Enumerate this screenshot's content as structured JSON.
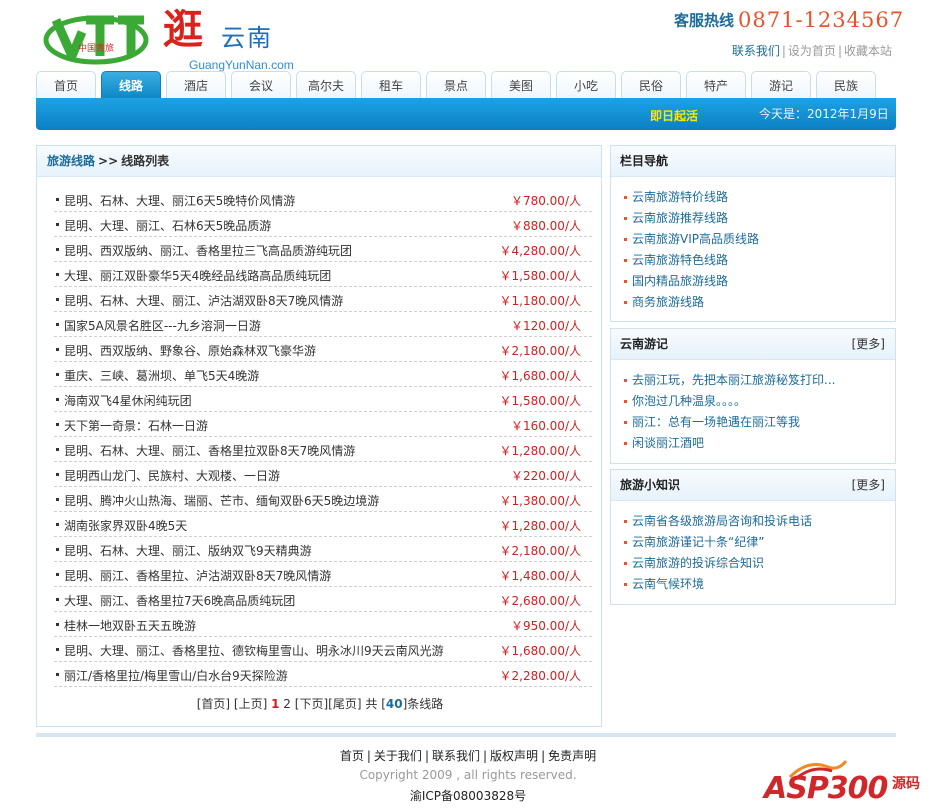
{
  "header": {
    "logo_vtt_text": "中国青旅",
    "logo_guang_big": "逛",
    "logo_guang_small": "云南",
    "logo_url": "GuangYunNan.com",
    "hotline_label": "客服热线",
    "hotline_number": "0871-1234567",
    "top_links": [
      "联系我们",
      "设为首页",
      "收藏本站"
    ]
  },
  "nav": {
    "tabs": [
      "首页",
      "线路",
      "酒店",
      "会议",
      "高尔夫",
      "租车",
      "景点",
      "美图",
      "小吃",
      "民俗",
      "特产",
      "游记",
      "民族"
    ],
    "active_index": 1
  },
  "banner": {
    "marquee": "即日起活",
    "today": "今天是：2012年1月9日"
  },
  "main": {
    "breadcrumb_root": "旅游线路",
    "breadcrumb_sep": ">>",
    "breadcrumb_current": "线路列表",
    "routes": [
      {
        "name": "昆明、石林、大理、丽江6天5晚特价风情游",
        "price": "￥780.00/人"
      },
      {
        "name": "昆明、大理、丽江、石林6天5晚品质游",
        "price": "￥880.00/人"
      },
      {
        "name": "昆明、西双版纳、丽江、香格里拉三飞高品质游纯玩团",
        "price": "￥4,280.00/人"
      },
      {
        "name": "大理、丽江双卧豪华5天4晚经品线路高品质纯玩团",
        "price": "￥1,580.00/人"
      },
      {
        "name": "昆明、石林、大理、丽江、泸沽湖双卧8天7晚风情游",
        "price": "￥1,180.00/人"
      },
      {
        "name": "国家5A风景名胜区---九乡溶洞一日游",
        "price": "￥120.00/人"
      },
      {
        "name": "昆明、西双版纳、野象谷、原始森林双飞豪华游",
        "price": "￥2,180.00/人"
      },
      {
        "name": "重庆、三峡、葛洲坝、单飞5天4晚游",
        "price": "￥1,680.00/人"
      },
      {
        "name": "海南双飞4星休闲纯玩团",
        "price": "￥1,580.00/人"
      },
      {
        "name": "天下第一奇景：石林一日游",
        "price": "￥160.00/人"
      },
      {
        "name": "昆明、石林、大理、丽江、香格里拉双卧8天7晚风情游",
        "price": "￥1,280.00/人"
      },
      {
        "name": "昆明西山龙门、民族村、大观楼、一日游",
        "price": "￥220.00/人"
      },
      {
        "name": "昆明、腾冲火山热海、瑞丽、芒市、缅甸双卧6天5晚边境游",
        "price": "￥1,380.00/人"
      },
      {
        "name": "湖南张家界双卧4晚5天",
        "price": "￥1,280.00/人"
      },
      {
        "name": "昆明、石林、大理、丽江、版纳双飞9天精典游",
        "price": "￥2,180.00/人"
      },
      {
        "name": "昆明、丽江、香格里拉、泸沽湖双卧8天7晚风情游",
        "price": "￥1,480.00/人"
      },
      {
        "name": "大理、丽江、香格里拉7天6晚高品质纯玩团",
        "price": "￥2,680.00/人"
      },
      {
        "name": "桂林一地双卧五天五晚游",
        "price": "￥950.00/人"
      },
      {
        "name": "昆明、大理、丽江、香格里拉、德钦梅里雪山、明永冰川9天云南风光游",
        "price": "￥1,680.00/人"
      },
      {
        "name": "丽江/香格里拉/梅里雪山/白水台9天探险游",
        "price": "￥2,280.00/人"
      }
    ],
    "pager": {
      "first": "[首页]",
      "prev": "[上页]",
      "current": "1",
      "other": "2",
      "next": "[下页]",
      "last": "[尾页]",
      "total_prefix": "共",
      "total_open": "[",
      "total": "40",
      "total_close": "]",
      "total_suffix": "条线路"
    }
  },
  "sidebar": {
    "nav_box": {
      "title": "栏目导航",
      "items": [
        "云南旅游特价线路",
        "云南旅游推荐线路",
        "云南旅游VIP高品质线路",
        "云南旅游特色线路",
        "国内精品旅游线路",
        "商务旅游线路"
      ]
    },
    "travel_notes": {
      "title": "云南游记",
      "more": "[更多]",
      "items": [
        "去丽江玩，先把本丽江旅游秘笈打印...",
        "你泡过几种温泉。。。。",
        "丽江：总有一场艳遇在丽江等我",
        "闲谈丽江酒吧"
      ]
    },
    "knowledge": {
      "title": "旅游小知识",
      "more": "[更多]",
      "items": [
        "云南省各级旅游局咨询和投诉电话",
        "云南旅游谨记十条“纪律”",
        "云南旅游的投诉综合知识",
        "云南气候环境"
      ]
    }
  },
  "footer": {
    "links": [
      "首页",
      "关于我们",
      "联系我们",
      "版权声明",
      "免责声明"
    ],
    "copyright": "Copyright 2009 , all rights reserved.",
    "icp": "渝ICP备08003828号"
  },
  "watermark": {
    "main": "ASP300",
    "sub": "源码"
  },
  "colors": {
    "brand_blue": "#0c86c6",
    "link_blue": "#1b6c9a",
    "price_red": "#d01f1f",
    "hotline_orange": "#e8532a"
  }
}
